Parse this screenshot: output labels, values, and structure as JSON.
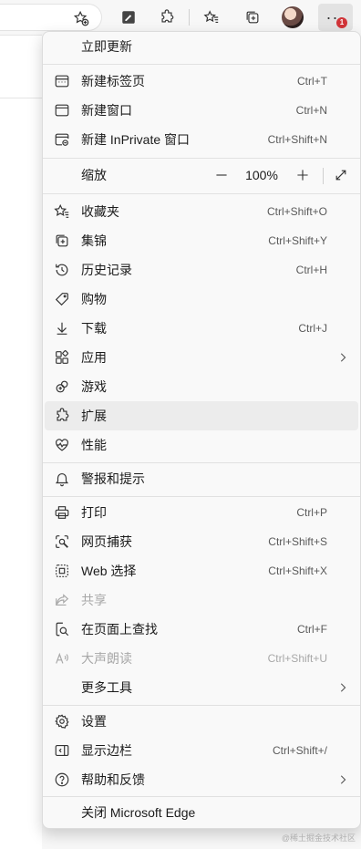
{
  "toolbar": {
    "more_badge": "1"
  },
  "menu": {
    "update": "立即更新",
    "new_tab": {
      "label": "新建标签页",
      "shortcut": "Ctrl+T"
    },
    "new_window": {
      "label": "新建窗口",
      "shortcut": "Ctrl+N"
    },
    "new_inprivate": {
      "label": "新建 InPrivate 窗口",
      "shortcut": "Ctrl+Shift+N"
    },
    "zoom": {
      "label": "缩放",
      "value": "100%"
    },
    "favorites": {
      "label": "收藏夹",
      "shortcut": "Ctrl+Shift+O"
    },
    "collections": {
      "label": "集锦",
      "shortcut": "Ctrl+Shift+Y"
    },
    "history": {
      "label": "历史记录",
      "shortcut": "Ctrl+H"
    },
    "shopping": {
      "label": "购物"
    },
    "downloads": {
      "label": "下载",
      "shortcut": "Ctrl+J"
    },
    "apps": {
      "label": "应用"
    },
    "games": {
      "label": "游戏"
    },
    "extensions": {
      "label": "扩展"
    },
    "performance": {
      "label": "性能"
    },
    "alerts": {
      "label": "警报和提示"
    },
    "print": {
      "label": "打印",
      "shortcut": "Ctrl+P"
    },
    "web_capture": {
      "label": "网页捕获",
      "shortcut": "Ctrl+Shift+S"
    },
    "web_select": {
      "label": "Web 选择",
      "shortcut": "Ctrl+Shift+X"
    },
    "share": {
      "label": "共享"
    },
    "find": {
      "label": "在页面上查找",
      "shortcut": "Ctrl+F"
    },
    "read_aloud": {
      "label": "大声朗读",
      "shortcut": "Ctrl+Shift+U"
    },
    "more_tools": {
      "label": "更多工具"
    },
    "settings": {
      "label": "设置"
    },
    "sidebar": {
      "label": "显示边栏",
      "shortcut": "Ctrl+Shift+/"
    },
    "help": {
      "label": "帮助和反馈"
    },
    "close": {
      "label": "关闭 Microsoft Edge"
    }
  },
  "watermark": "@稀土掘金技术社区",
  "colors": {
    "menu_bg": "#f9f9f9",
    "highlight": "#ececec",
    "badge": "#d13438",
    "disabled": "#a8a8a8"
  }
}
